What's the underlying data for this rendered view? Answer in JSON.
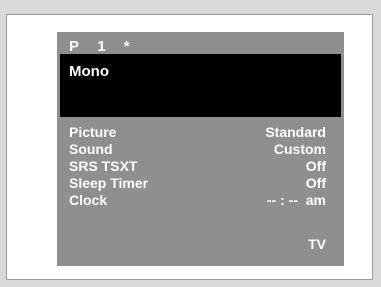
{
  "header": {
    "program": "P",
    "channel": "1",
    "marker": "*"
  },
  "audio_mode": "Mono",
  "menu": [
    {
      "label": "Picture",
      "value": "Standard"
    },
    {
      "label": "Sound",
      "value": "Custom"
    },
    {
      "label": "SRS TSXT",
      "value": "Off"
    },
    {
      "label": "Sleep Timer",
      "value": "Off"
    },
    {
      "label": "Clock",
      "value": "-- : --  am"
    }
  ],
  "source": "TV"
}
